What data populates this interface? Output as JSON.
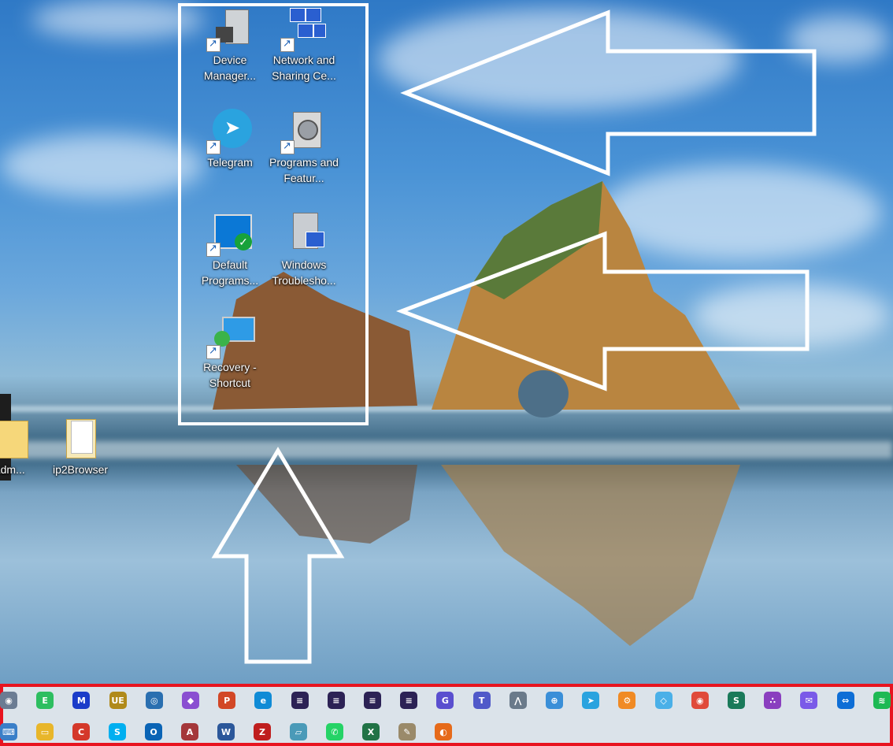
{
  "desktop": {
    "icons": [
      {
        "label": "Device Manager...",
        "icon": "device-manager-icon"
      },
      {
        "label": "Network and Sharing Ce...",
        "icon": "network-sharing-icon"
      },
      {
        "label": "Telegram",
        "icon": "telegram-icon"
      },
      {
        "label": "Programs and Featur...",
        "icon": "programs-features-icon"
      },
      {
        "label": "Default Programs...",
        "icon": "default-programs-icon"
      },
      {
        "label": "Windows Troublesho...",
        "icon": "windows-troubleshoot-icon"
      },
      {
        "label": "Recovery - Shortcut",
        "icon": "recovery-icon"
      }
    ],
    "other_icons": [
      {
        "label": "yAdm...",
        "icon": "folder-icon"
      },
      {
        "label": "ip2Browser",
        "icon": "folder-icon"
      }
    ]
  },
  "colors": {
    "highlight": "#ffffff",
    "taskbar_border": "#e8141f",
    "taskbar_bg": "#dbe3ea"
  },
  "taskbar": {
    "row1": [
      {
        "icon": "camera-icon",
        "color": "#6b7c93",
        "glyph": "◉"
      },
      {
        "icon": "evernote-icon",
        "color": "#2dbe60",
        "glyph": "E"
      },
      {
        "icon": "malwarebytes-icon",
        "color": "#1b3cc9",
        "glyph": "M"
      },
      {
        "icon": "ultraedit-icon",
        "color": "#b08a1a",
        "glyph": "UE"
      },
      {
        "icon": "network-globe-icon",
        "color": "#2a6fb0",
        "glyph": "◎"
      },
      {
        "icon": "visual-studio-icon",
        "color": "#8a4fd1",
        "glyph": "◆"
      },
      {
        "icon": "powerpoint-icon",
        "color": "#d24726",
        "glyph": "P"
      },
      {
        "icon": "edge-icon",
        "color": "#0f8bd6",
        "glyph": "e"
      },
      {
        "icon": "eclipse-icon",
        "color": "#2c2255",
        "glyph": "≡"
      },
      {
        "icon": "eclipse-icon-2",
        "color": "#2c2255",
        "glyph": "≡"
      },
      {
        "icon": "eclipse-icon-3",
        "color": "#2c2255",
        "glyph": "≡"
      },
      {
        "icon": "eclipse-icon-4",
        "color": "#2c2255",
        "glyph": "≡"
      },
      {
        "icon": "github-desktop-icon",
        "color": "#5a4fcf",
        "glyph": "G"
      },
      {
        "icon": "teams-icon",
        "color": "#5059c9",
        "glyph": "T"
      },
      {
        "icon": "chart-tool-icon",
        "color": "#6a7a8a",
        "glyph": "⋀"
      },
      {
        "icon": "safari-icon",
        "color": "#3a8fd8",
        "glyph": "⊕"
      },
      {
        "icon": "telegram-taskbar-icon",
        "color": "#2aa3df",
        "glyph": "➤"
      },
      {
        "icon": "settings-gear-icon",
        "color": "#f08a24",
        "glyph": "⚙"
      },
      {
        "icon": "diamond-app-icon",
        "color": "#4ab0e8",
        "glyph": "◇"
      },
      {
        "icon": "chrome-icon",
        "color": "#e04a3a",
        "glyph": "◉"
      },
      {
        "icon": "network-tool-icon",
        "color": "#1a7a5a",
        "glyph": "S"
      },
      {
        "icon": "asana-icon",
        "color": "#8a3fbf",
        "glyph": "∴"
      },
      {
        "icon": "messenger-icon",
        "color": "#7a5ae8",
        "glyph": "✉"
      },
      {
        "icon": "teamviewer-icon",
        "color": "#0e6ed6",
        "glyph": "⇔"
      },
      {
        "icon": "spotify-icon",
        "color": "#1db954",
        "glyph": "≋"
      }
    ],
    "row2": [
      {
        "icon": "keyboard-icon",
        "color": "#3a7fc8",
        "glyph": "⌨"
      },
      {
        "icon": "file-explorer-icon",
        "color": "#e8b62a",
        "glyph": "▭"
      },
      {
        "icon": "ccleaner-icon",
        "color": "#d4382a",
        "glyph": "C"
      },
      {
        "icon": "skype-icon",
        "color": "#00aff0",
        "glyph": "S"
      },
      {
        "icon": "outlook-icon",
        "color": "#0a64b5",
        "glyph": "O"
      },
      {
        "icon": "access-icon",
        "color": "#a4373a",
        "glyph": "A"
      },
      {
        "icon": "word-icon",
        "color": "#2b579a",
        "glyph": "W"
      },
      {
        "icon": "filezilla-icon",
        "color": "#bf1e1e",
        "glyph": "Z"
      },
      {
        "icon": "notes-app-icon",
        "color": "#4a9ab8",
        "glyph": "▱"
      },
      {
        "icon": "whatsapp-icon",
        "color": "#25d366",
        "glyph": "✆"
      },
      {
        "icon": "excel-icon",
        "color": "#217346",
        "glyph": "X"
      },
      {
        "icon": "paint-icon",
        "color": "#9a8a6a",
        "glyph": "✎"
      },
      {
        "icon": "firefox-icon",
        "color": "#e66a1a",
        "glyph": "◐"
      }
    ]
  }
}
